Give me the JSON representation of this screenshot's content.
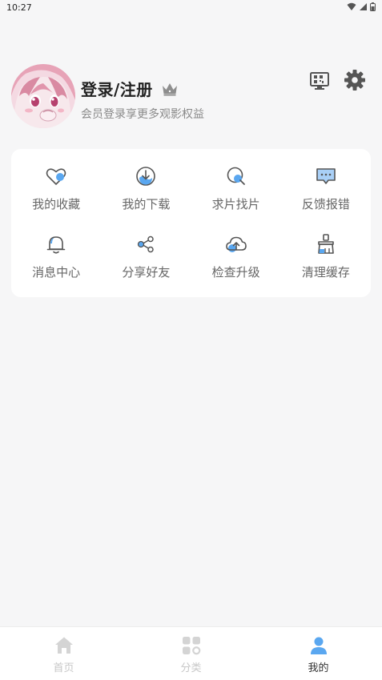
{
  "status_bar": {
    "time": "10:27"
  },
  "user": {
    "title": "登录/注册",
    "subtitle": "会员登录享更多观影权益"
  },
  "icons": {
    "qr": "qr-code-icon",
    "settings": "gear-icon",
    "crown": "crown-icon"
  },
  "menu": {
    "items": [
      {
        "label": "我的收藏",
        "icon": "heart-icon"
      },
      {
        "label": "我的下载",
        "icon": "download-icon"
      },
      {
        "label": "求片找片",
        "icon": "search-icon"
      },
      {
        "label": "反馈报错",
        "icon": "feedback-chat-icon"
      },
      {
        "label": "消息中心",
        "icon": "bell-icon"
      },
      {
        "label": "分享好友",
        "icon": "share-icon"
      },
      {
        "label": "检查升级",
        "icon": "cloud-upload-icon"
      },
      {
        "label": "清理缓存",
        "icon": "broom-icon"
      }
    ]
  },
  "bottom_nav": {
    "items": [
      {
        "label": "首页",
        "icon": "home-icon",
        "active": false
      },
      {
        "label": "分类",
        "icon": "category-grid-icon",
        "active": false
      },
      {
        "label": "我的",
        "icon": "profile-icon",
        "active": true
      }
    ]
  },
  "colors": {
    "accent": "#5aa7f0",
    "background": "#f6f6f7",
    "icon_stroke": "#555555",
    "inactive_nav": "#d4d4d4"
  }
}
